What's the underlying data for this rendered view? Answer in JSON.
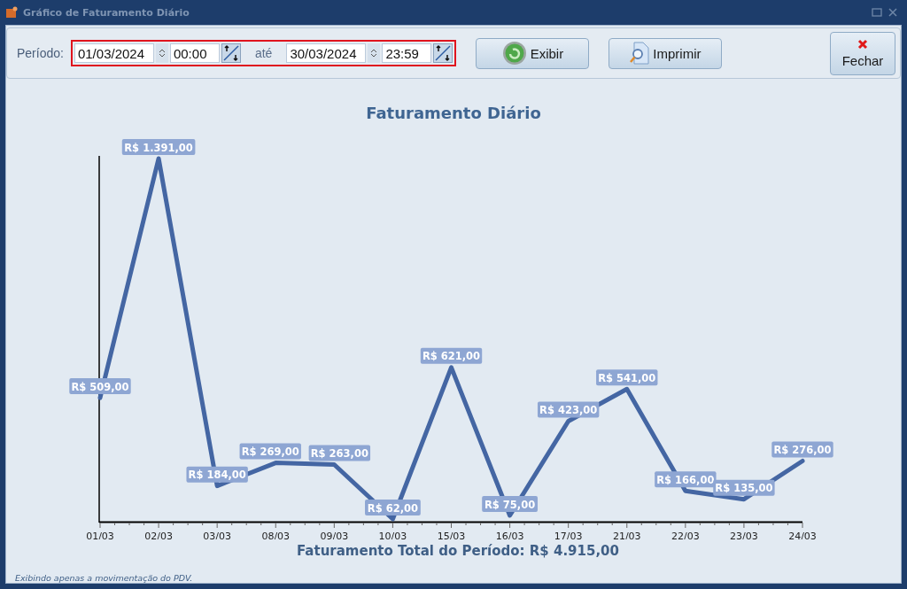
{
  "window": {
    "title": "Gráfico de Faturamento Diário"
  },
  "toolbar": {
    "period_label": "Período:",
    "start_date": "01/03/2024",
    "start_time": "00:00",
    "until_label": "até",
    "end_date": "30/03/2024",
    "end_time": "23:59",
    "buttons": [
      {
        "label": "Exibir",
        "kind": "refresh"
      },
      {
        "label": "Imprimir",
        "kind": "preview"
      },
      {
        "label": "Fechar",
        "kind": "close"
      }
    ]
  },
  "chart": {
    "chart_data": {
      "type": "line",
      "title": "Faturamento Diário",
      "categories": [
        "01/03",
        "02/03",
        "03/03",
        "08/03",
        "09/03",
        "10/03",
        "15/03",
        "16/03",
        "17/03",
        "21/03",
        "22/03",
        "23/03",
        "24/03"
      ],
      "series": [
        {
          "color": "#4466a3",
          "values": [
            509,
            1391,
            184,
            269,
            263,
            62,
            621,
            75,
            423,
            541,
            166,
            135,
            276
          ],
          "value_labels": [
            "R$ 509,00",
            "R$ 1.391,00",
            "R$ 184,00",
            "R$ 269,00",
            "R$ 263,00",
            "R$ 62,00",
            "R$ 621,00",
            "R$ 75,00",
            "R$ 423,00",
            "R$ 541,00",
            "R$ 166,00",
            "R$ 135,00",
            "R$ 276,00"
          ]
        }
      ]
    },
    "total": "Faturamento Total do Período: R$ 4.915,00"
  },
  "footnote": "Exibindo apenas a movimentação do PDV."
}
